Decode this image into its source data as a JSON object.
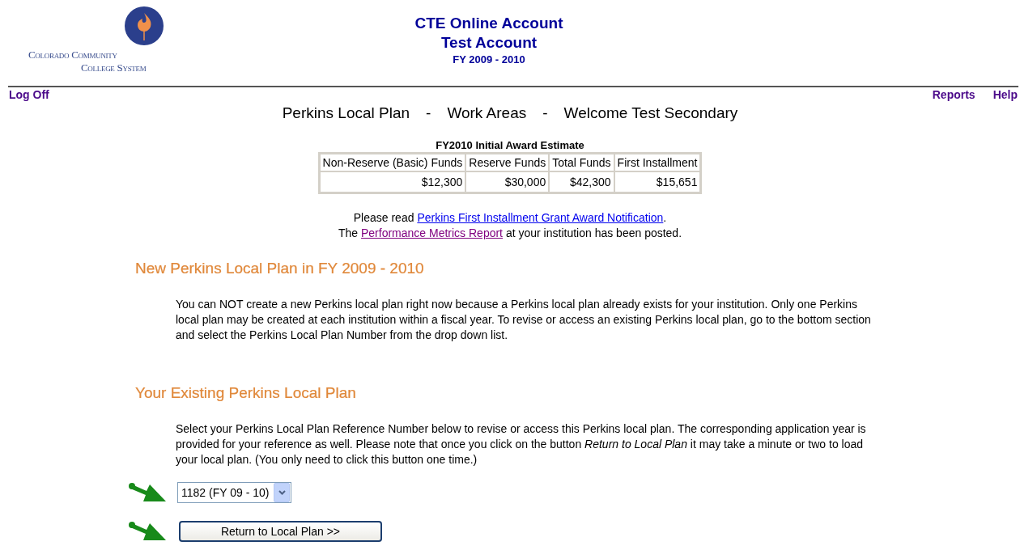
{
  "logo": {
    "lines": [
      "Colorado Community",
      "College System"
    ]
  },
  "header": {
    "lines": [
      "CTE Online Account",
      "Test Account",
      "FY 2009 - 2010"
    ]
  },
  "nav": {
    "left": [
      "Log Off"
    ],
    "right": [
      "Reports",
      "Help"
    ]
  },
  "breadcrumb": [
    "Perkins Local Plan",
    "-",
    "Work Areas",
    "-",
    "Welcome Test Secondary"
  ],
  "award_table": {
    "caption": "FY2010 Initial Award Estimate",
    "columns": [
      "Non-Reserve (Basic) Funds",
      "Reserve Funds",
      "Total Funds",
      "First Installment"
    ],
    "rows": [
      [
        "$12,300",
        "$30,000",
        "$42,300",
        "$15,651"
      ]
    ]
  },
  "notices": [
    {
      "before": "Please read ",
      "link": "Perkins First Installment Grant Award Notification",
      "after": ".",
      "visited": false
    },
    {
      "before": "The ",
      "link": "Performance Metrics Report",
      "after": " at your institution has been posted.",
      "visited": true
    }
  ],
  "sections": [
    {
      "heading": "New Perkins Local Plan in FY 2009 - 2010",
      "text": "You can NOT create a new Perkins local plan right now because a Perkins local plan already exists for your institution. Only one Perkins local plan may be created at each institution within a fiscal year. To revise or access an existing Perkins local plan, go to the bottom section and select the Perkins Local Plan Number from the drop down list."
    },
    {
      "heading": "Your Existing Perkins Local Plan",
      "text": "Select your Perkins Local Plan Reference Number below to revise or access this Perkins local plan. The corresponding application year is provided for your reference as well. Please note that once you click on the button *Return to Local Plan* it may take a minute or two to load your local plan. (You only need to click this button one time.)"
    }
  ],
  "plan_select": {
    "value": "1182 (FY 09 - 10)"
  },
  "return_button": {
    "label": "Return to Local Plan >>"
  }
}
